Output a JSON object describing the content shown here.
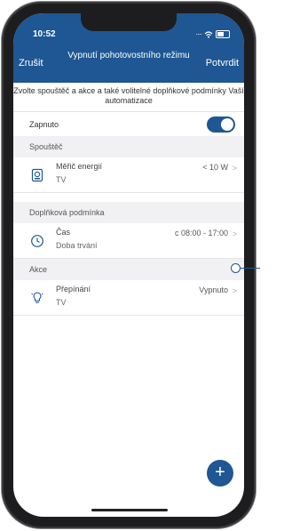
{
  "status_bar": {
    "time": "10:52"
  },
  "nav": {
    "cancel": "Zrušit",
    "title": "Vypnutí pohotovostního režimu",
    "confirm": "Potvrdit"
  },
  "info_text": "Zvolte spouštěč a akce a také volitelné doplňkové podmínky Vaší automatizace",
  "enabled": {
    "label": "Zapnuto",
    "value": true
  },
  "sections": {
    "trigger": "Spouštěč",
    "condition": "Doplňková podmínka",
    "action": "Akce"
  },
  "trigger_item": {
    "icon": "energy-meter-icon",
    "title": "Měřič energií",
    "subtitle": "TV",
    "value": "< 10 W"
  },
  "condition_item": {
    "icon": "clock-icon",
    "title": "Čas",
    "subtitle": "Doba trvání",
    "value": "c 08:00 - 17:00"
  },
  "action_item": {
    "icon": "lightbulb-icon",
    "title": "Přepínání",
    "subtitle": "TV",
    "value": "Vypnuto"
  },
  "colors": {
    "accent": "#1e5793",
    "section_bg": "#f1f1f4"
  }
}
